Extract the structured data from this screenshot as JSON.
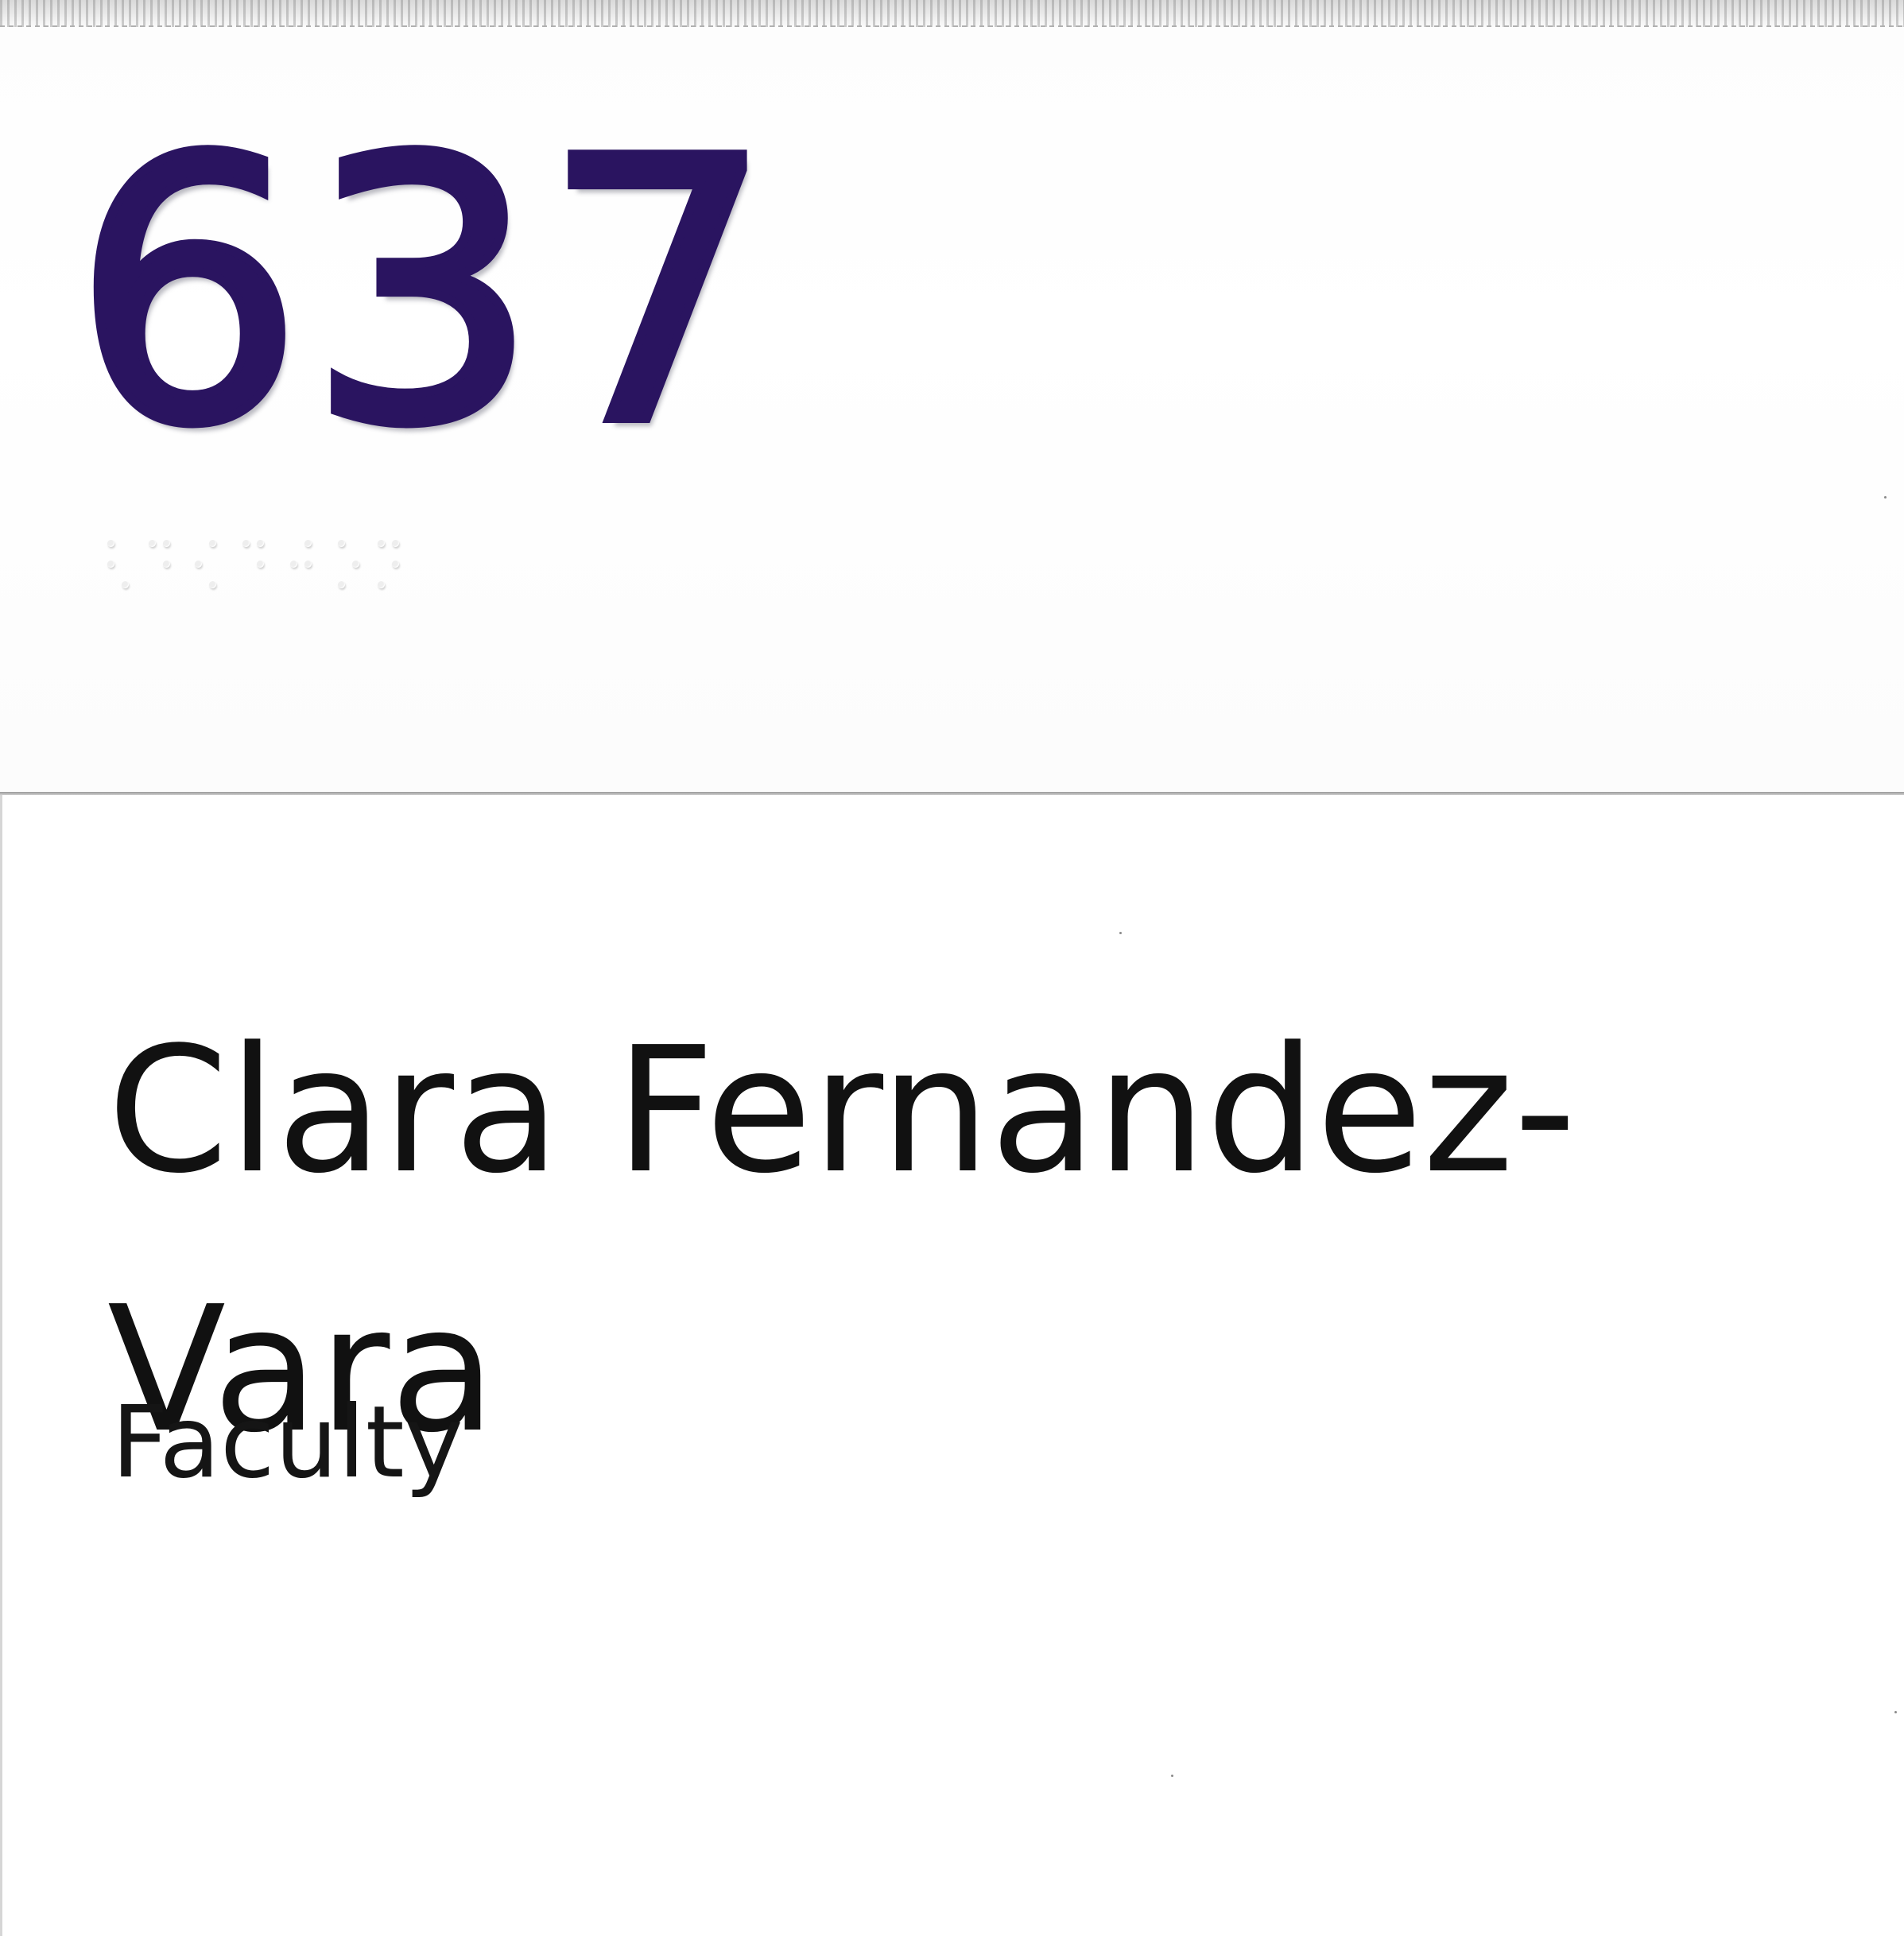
{
  "sign": {
    "room_number": "637",
    "occupant_name": "Clara Fernandez-\nVara",
    "occupant_role": "Faculty"
  },
  "colors": {
    "room_number": "#2a1460",
    "name_text": "#111111",
    "background": "#ffffff"
  }
}
